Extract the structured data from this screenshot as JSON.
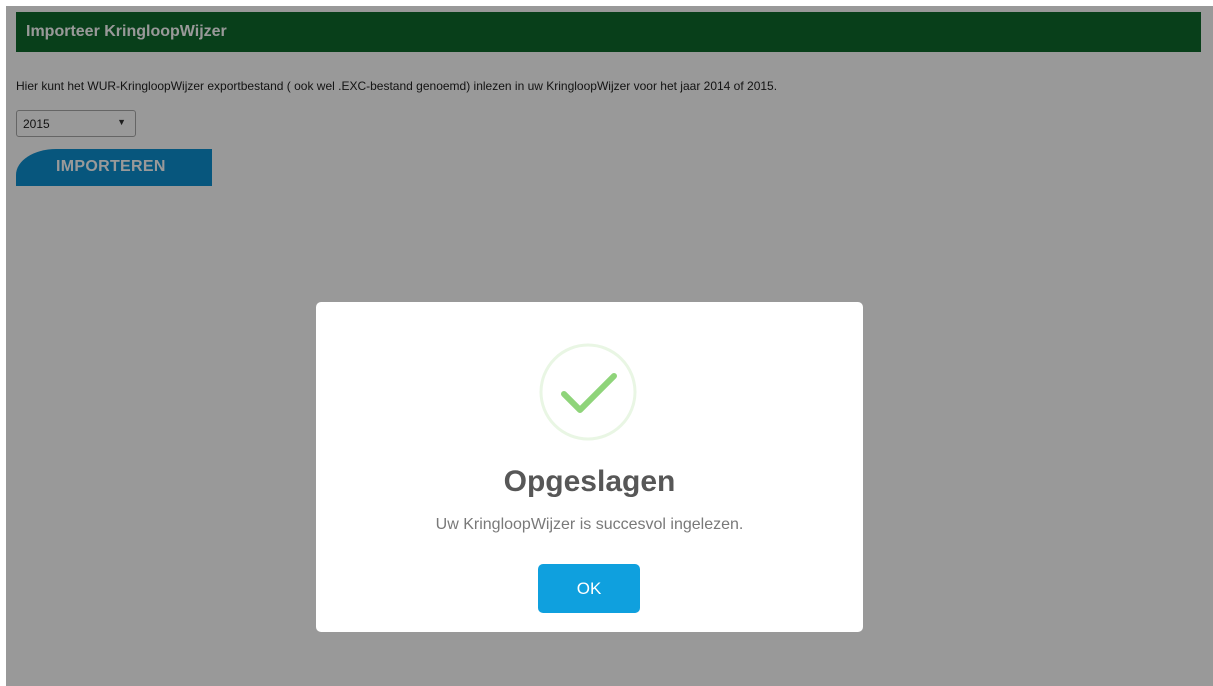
{
  "header": {
    "title": "Importeer KringloopWijzer"
  },
  "intro": {
    "text": "Hier kunt het WUR-KringloopWijzer exportbestand ( ook wel .EXC-bestand genoemd) inlezen in uw KringloopWijzer voor het jaar 2014 of 2015."
  },
  "year_select": {
    "value": "2015",
    "caret_icon": "chevron-down-icon"
  },
  "import_button": {
    "label": "IMPORTEREN"
  },
  "modal": {
    "icon": "success-checkmark-icon",
    "title": "Opgeslagen",
    "message": "Uw KringloopWijzer is succesvol ingelezen.",
    "ok_label": "OK"
  },
  "colors": {
    "header_bg": "#0e6a2c",
    "button_blue": "#0d8fd0",
    "ok_blue": "#0fa0de",
    "check_green": "#8fd47a",
    "overlay": "rgba(0,0,0,0.4)"
  }
}
